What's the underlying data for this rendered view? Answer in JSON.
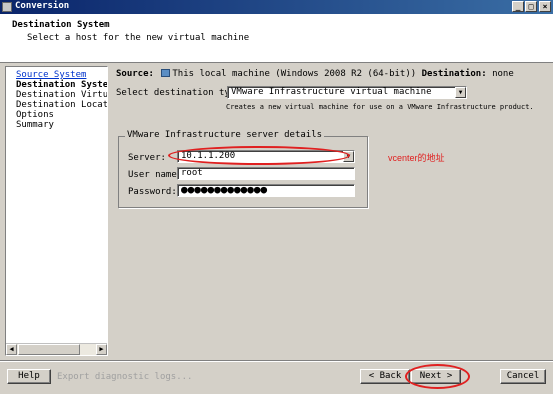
{
  "window": {
    "title": "Conversion",
    "buttons": {
      "minimize": "_",
      "maximize": "□",
      "close": "×"
    }
  },
  "header": {
    "title": "Destination System",
    "subtitle": "Select a host for the new virtual machine"
  },
  "nav": {
    "items": [
      {
        "label": "Source System",
        "state": "link"
      },
      {
        "label": "Destination System",
        "state": "current"
      },
      {
        "label": "Destination Virtual M",
        "state": "normal"
      },
      {
        "label": "Destination Location",
        "state": "normal"
      },
      {
        "label": "Options",
        "state": "normal"
      },
      {
        "label": "Summary",
        "state": "normal"
      }
    ]
  },
  "main": {
    "source_label": "Source:",
    "source_value": "This local machine (Windows 2008 R2 (64-bit))",
    "destination_label": "Destination:",
    "destination_value": "none",
    "dest_type_label": "Select destination type:",
    "dest_type_value": "VMware Infrastructure virtual machine",
    "dest_type_desc": "Creates a new virtual machine for use on a VMware Infrastructure product.",
    "group_title": "VMware Infrastructure server details",
    "server_label": "Server:",
    "server_value": "10.1.1.200",
    "username_label": "User name:",
    "username_value": "root",
    "password_label": "Password:",
    "password_value": "●●●●●●●●●●●●●"
  },
  "annotation": {
    "text": "vcenter的地址",
    "color": "#e02020"
  },
  "footer": {
    "help": "Help",
    "export_logs": "Export diagnostic logs...",
    "back": "< Back",
    "next": "Next >",
    "cancel": "Cancel"
  }
}
